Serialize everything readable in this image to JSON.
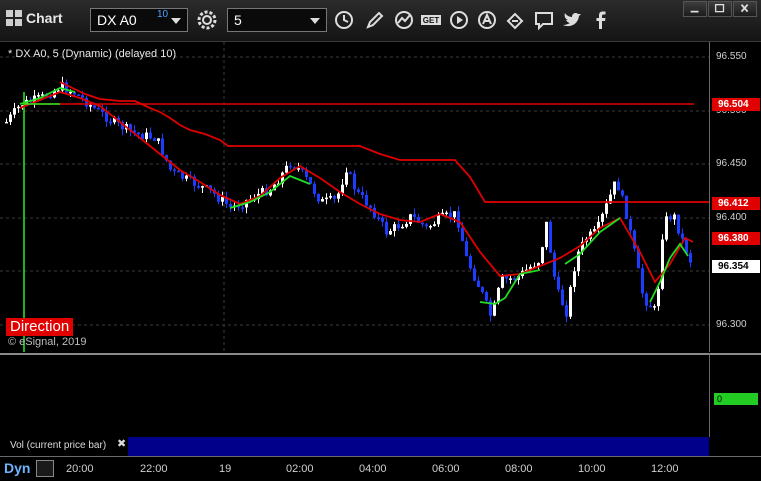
{
  "toolbar": {
    "title": "Chart",
    "symbol_value": "DX A0",
    "symbol_superscript": "10",
    "interval_value": "5",
    "icons": [
      "settings-gear-icon",
      "clock-icon",
      "pencil-icon",
      "study-icon",
      "get-icon",
      "play-icon",
      "alert-icon",
      "link-icon",
      "comment-icon",
      "twitter-icon",
      "facebook-icon"
    ]
  },
  "chart": {
    "legend": "* DX A0, 5 (Dynamic) (delayed 10)",
    "direction_label": "Direction",
    "copyright": "© eSignal, 2019",
    "price_axis": [
      "96.550",
      "96.500",
      "96.450",
      "96.400",
      "96.350",
      "96.300"
    ],
    "price_tags": {
      "high_line": "96.504",
      "mid_line": "96.412",
      "red_ma": "96.380",
      "last": "96.354"
    },
    "colors": {
      "up": "#ffffff",
      "down": "#1e3cff",
      "red_line": "#e00000",
      "green_line": "#22dd22"
    }
  },
  "volume": {
    "label": "Vol (current price bar)",
    "close_symbol": "✖",
    "value": "0"
  },
  "time_axis": {
    "mode": "Dyn",
    "labels": [
      "20:00",
      "22:00",
      "19",
      "02:00",
      "04:00",
      "06:00",
      "08:00",
      "10:00",
      "12:00"
    ]
  }
}
